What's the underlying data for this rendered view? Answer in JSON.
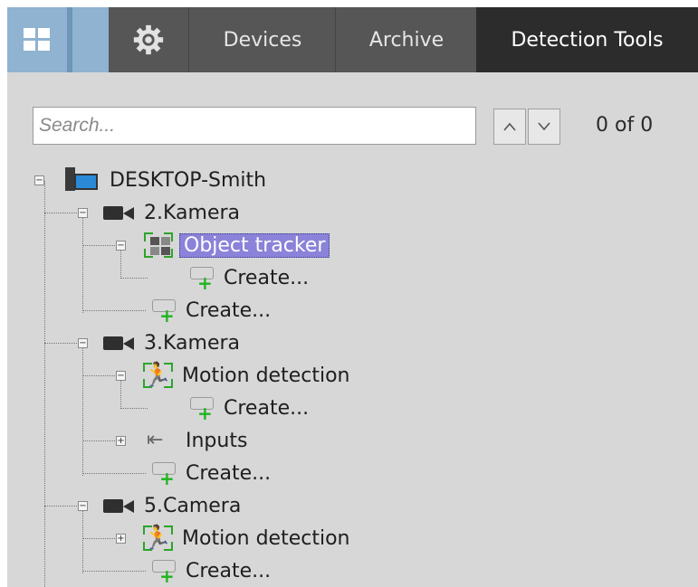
{
  "topbar": {
    "tabs": [
      "Devices",
      "Archive",
      "Detection Tools"
    ],
    "active_tab": "Detection Tools",
    "icons": [
      "layouts-grid-icon",
      "gear-icon"
    ]
  },
  "search": {
    "placeholder": "Search...",
    "counter": "0 of 0",
    "up_glyph": "^",
    "down_glyph": "v"
  },
  "tree": {
    "server": "DESKTOP-Smith",
    "cameras": [
      {
        "name": "2.Kamera",
        "tools": [
          {
            "name": "Object tracker",
            "selected": true,
            "children": [
              "Create..."
            ]
          }
        ],
        "create": "Create..."
      },
      {
        "name": "3.Kamera",
        "tools": [
          {
            "name": "Motion detection",
            "children": [
              "Create..."
            ]
          },
          {
            "name": "Inputs"
          }
        ],
        "create": "Create..."
      },
      {
        "name": "5.Camera",
        "tools": [
          {
            "name": "Motion detection"
          }
        ],
        "create": "Create..."
      }
    ]
  },
  "colors": {
    "topbar": "#4a4a4a",
    "active_tab": "#2c2c2c",
    "layouts_button": "#8fb3d1",
    "panel": "#d7d7d7",
    "selection": "#8b82d9",
    "create_plus": "#1eb51e"
  }
}
